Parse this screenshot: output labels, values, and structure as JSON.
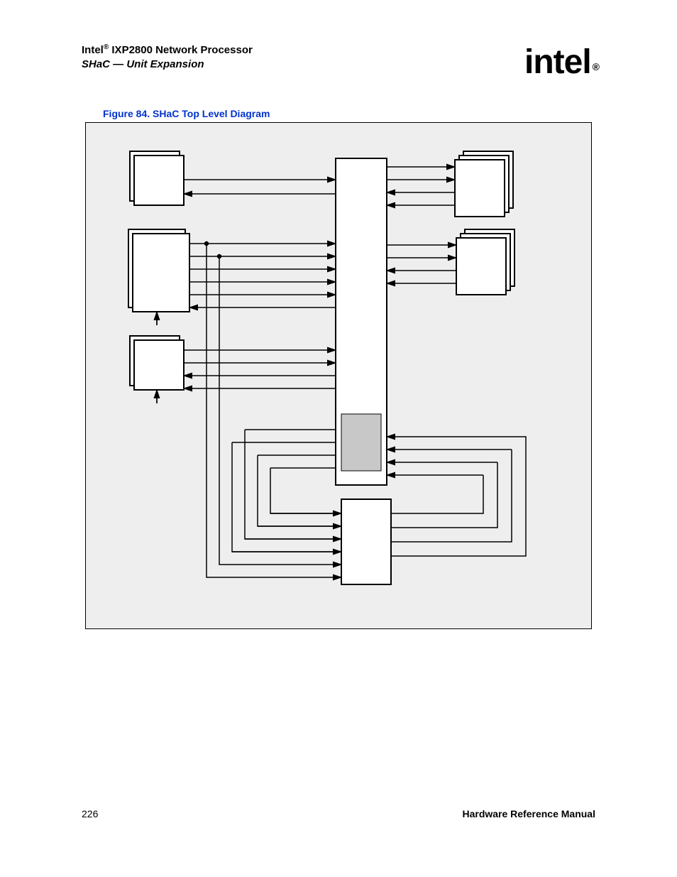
{
  "header": {
    "brand": "Intel",
    "reg": "®",
    "product": "IXP2800 Network Processor",
    "subtitle": "SHaC — Unit Expansion"
  },
  "logo": {
    "text": "intel",
    "reg": "®"
  },
  "figure": {
    "caption": "Figure 84. SHaC Top Level Diagram",
    "blocks": {
      "center": "",
      "center_gray": "",
      "left_top": "",
      "left_mid": "",
      "left_bot": "",
      "right_top": "",
      "right_mid": "",
      "bottom": ""
    }
  },
  "footer": {
    "page": "226",
    "manual": "Hardware Reference Manual"
  }
}
